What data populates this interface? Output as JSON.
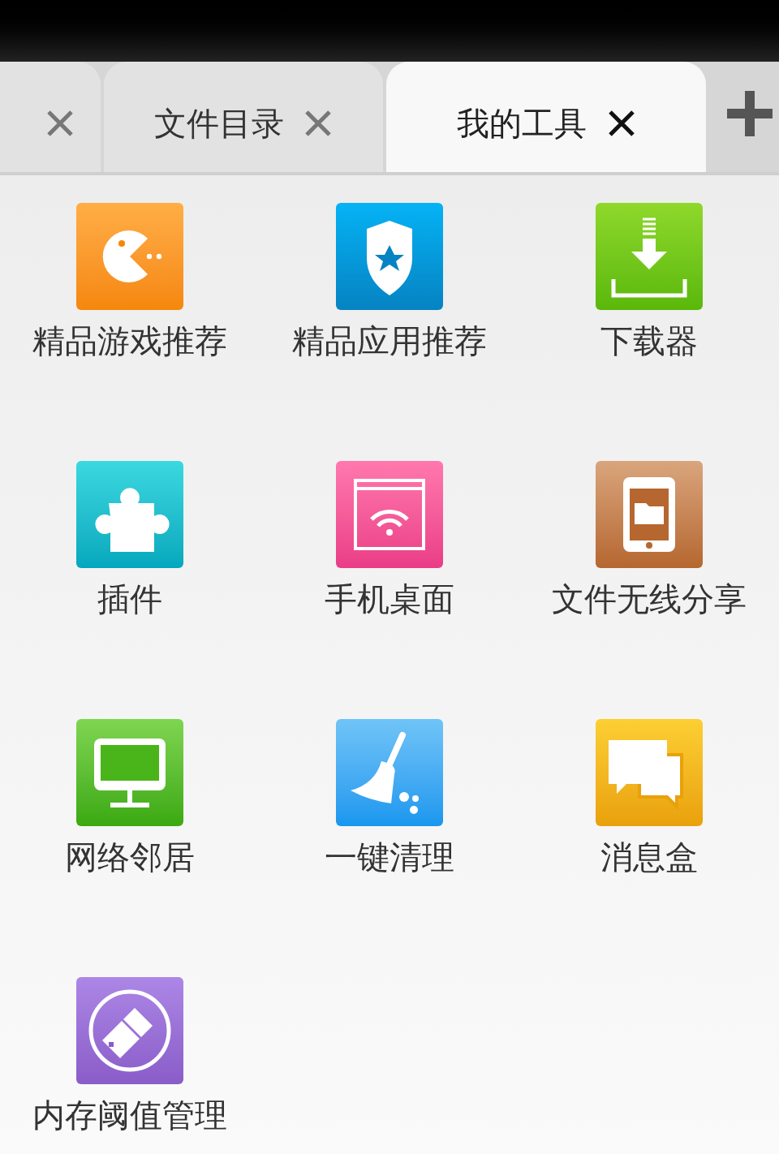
{
  "tabs": [
    {
      "selected": false
    },
    {
      "label": "文件目录",
      "selected": false
    },
    {
      "label": "我的工具",
      "selected": true
    }
  ],
  "tools": [
    {
      "label": "精品游戏推荐"
    },
    {
      "label": "精品应用推荐"
    },
    {
      "label": "下载器"
    },
    {
      "label": "插件"
    },
    {
      "label": "手机桌面"
    },
    {
      "label": "文件无线分享"
    },
    {
      "label": "网络邻居"
    },
    {
      "label": "一键清理"
    },
    {
      "label": "消息盒"
    },
    {
      "label": "内存阈值管理"
    }
  ]
}
